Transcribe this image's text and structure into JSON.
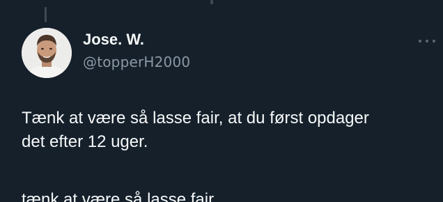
{
  "tweet": {
    "author": {
      "display_name": "Jose. W.",
      "handle": "@topperH2000",
      "avatar_icon": "profile-photo"
    },
    "more_icon": "more-options-icon",
    "text": "Tænk at være så lasse fair, at du først opdager\ndet efter 12 uger.",
    "next_line_partial": "tænk at være så lasse fair"
  },
  "colors": {
    "background": "#15202b",
    "text_primary": "#f7f9f9",
    "text_secondary": "#8b98a5",
    "thread_line": "#3d4a55"
  }
}
